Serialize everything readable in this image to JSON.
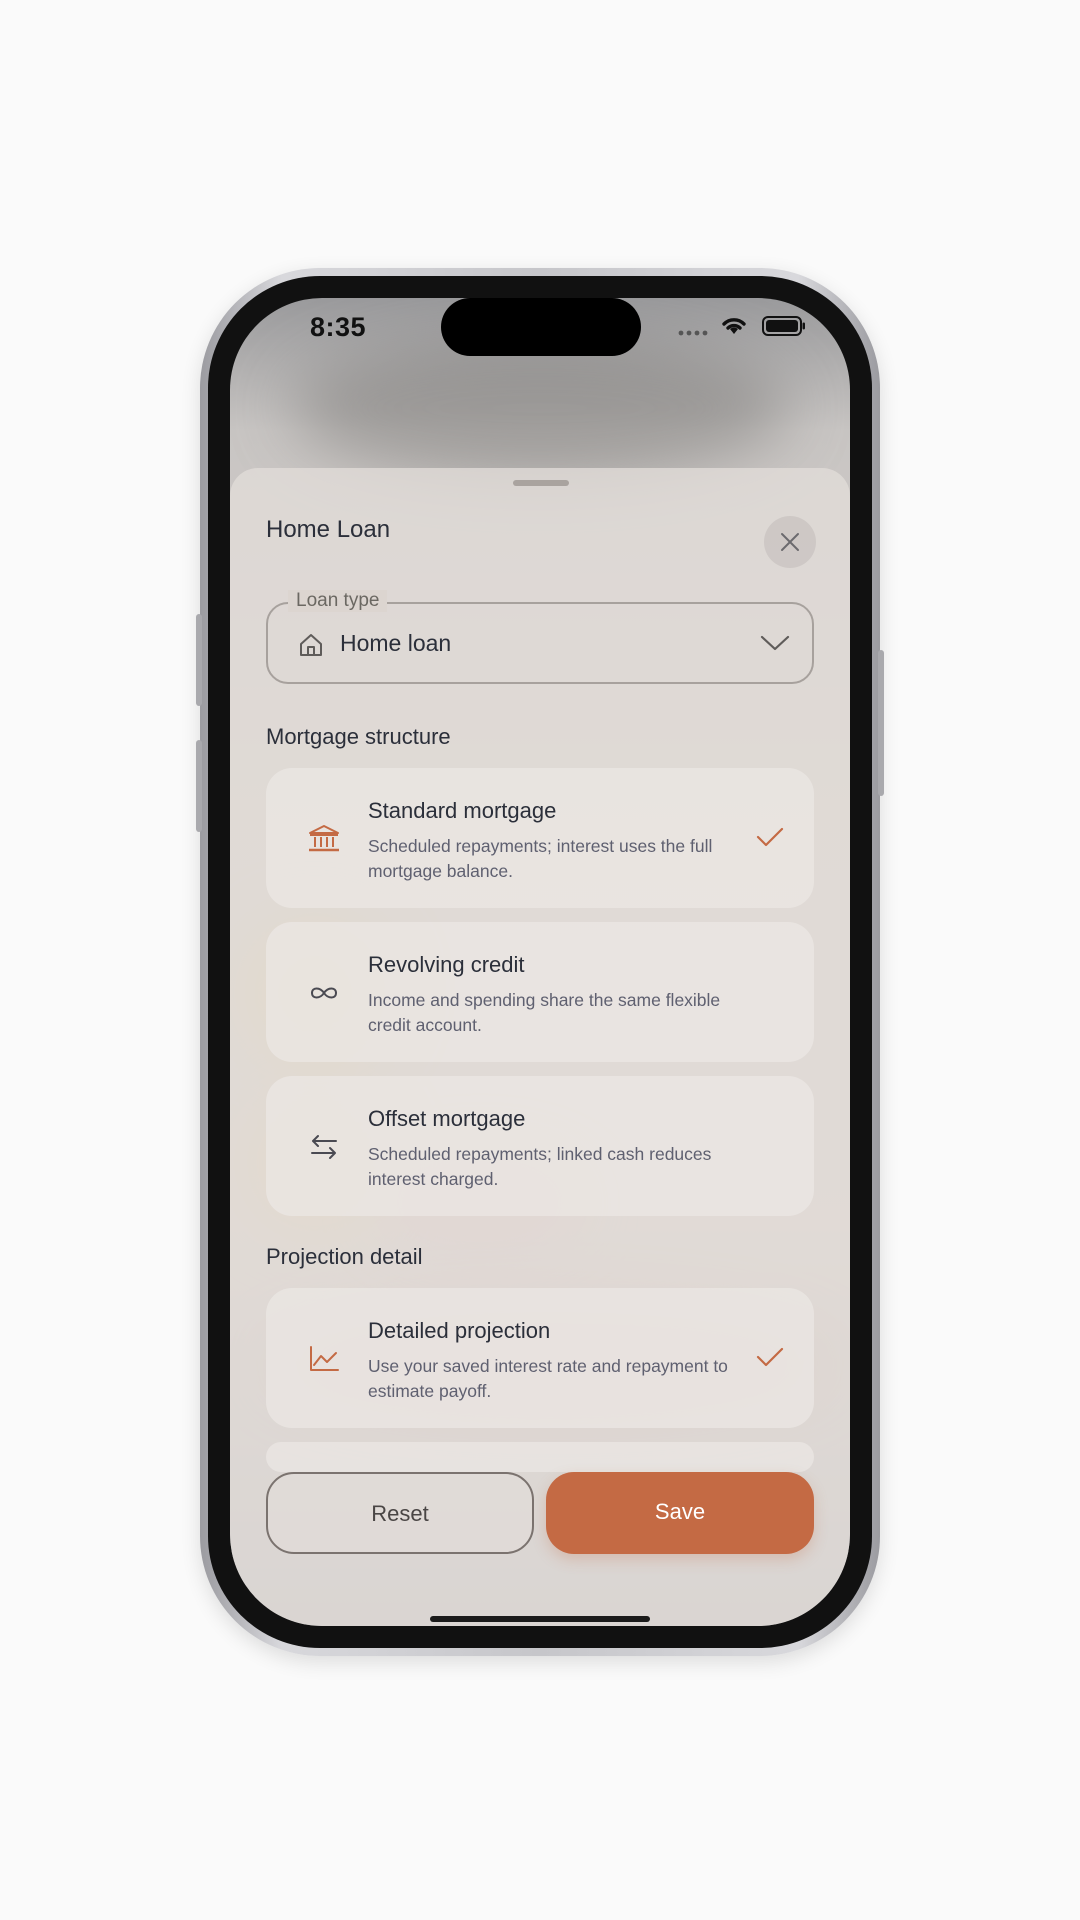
{
  "status_bar": {
    "time": "8:35"
  },
  "sheet": {
    "title": "Home Loan",
    "close_icon": "close-icon"
  },
  "loan_type": {
    "label": "Loan type",
    "value": "Home loan",
    "icon": "home-icon"
  },
  "mortgage_structure": {
    "heading": "Mortgage structure",
    "options": [
      {
        "title": "Standard mortgage",
        "description": "Scheduled repayments; interest uses the full mortgage balance.",
        "icon": "bank-icon",
        "selected": true
      },
      {
        "title": "Revolving credit",
        "description": "Income and spending share the same flexible credit account.",
        "icon": "infinity-icon",
        "selected": false
      },
      {
        "title": "Offset mortgage",
        "description": "Scheduled repayments; linked cash reduces interest charged.",
        "icon": "swap-arrows-icon",
        "selected": false
      }
    ]
  },
  "projection_detail": {
    "heading": "Projection detail",
    "options": [
      {
        "title": "Detailed projection",
        "description": "Use your saved interest rate and repayment to estimate payoff.",
        "icon": "line-chart-icon",
        "selected": true
      }
    ]
  },
  "footer": {
    "reset_label": "Reset",
    "save_label": "Save"
  },
  "colors": {
    "accent": "#c46a44",
    "text_primary": "#2b2f3a",
    "text_secondary": "#5f6070"
  }
}
